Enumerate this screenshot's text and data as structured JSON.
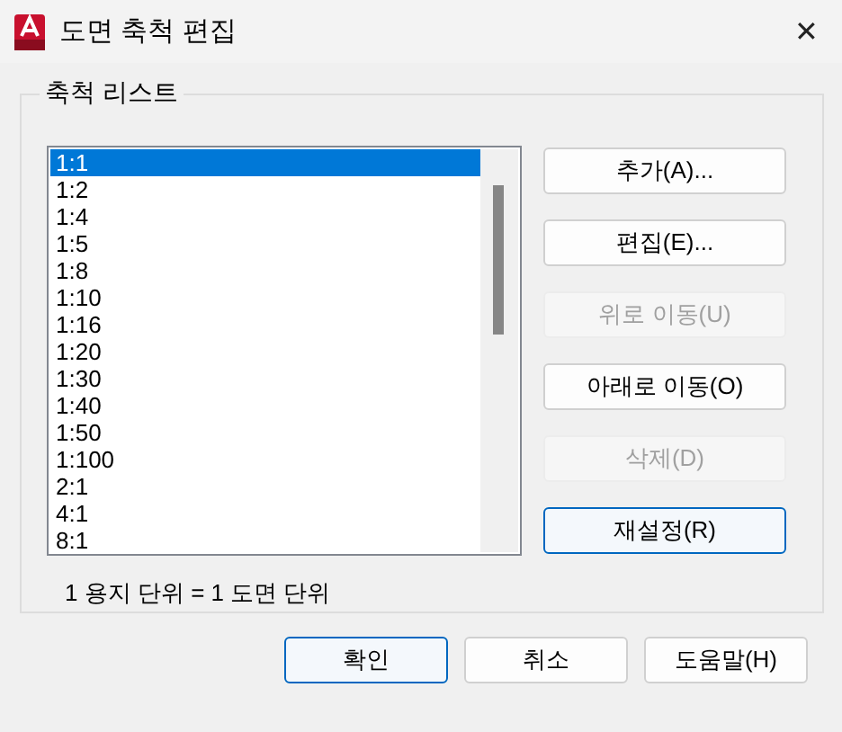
{
  "window": {
    "title": "도면 축척 편집",
    "close": "✕"
  },
  "group": {
    "title": "축척 리스트"
  },
  "scales": [
    {
      "label": "1:1",
      "selected": true
    },
    {
      "label": "1:2",
      "selected": false
    },
    {
      "label": "1:4",
      "selected": false
    },
    {
      "label": "1:5",
      "selected": false
    },
    {
      "label": "1:8",
      "selected": false
    },
    {
      "label": "1:10",
      "selected": false
    },
    {
      "label": "1:16",
      "selected": false
    },
    {
      "label": "1:20",
      "selected": false
    },
    {
      "label": "1:30",
      "selected": false
    },
    {
      "label": "1:40",
      "selected": false
    },
    {
      "label": "1:50",
      "selected": false
    },
    {
      "label": "1:100",
      "selected": false
    },
    {
      "label": "2:1",
      "selected": false
    },
    {
      "label": "4:1",
      "selected": false
    },
    {
      "label": "8:1",
      "selected": false
    }
  ],
  "side_buttons": [
    {
      "label": "추가(A)...",
      "disabled": false,
      "focused": false
    },
    {
      "label": "편집(E)...",
      "disabled": false,
      "focused": false
    },
    {
      "label": "위로 이동(U)",
      "disabled": true,
      "focused": false
    },
    {
      "label": "아래로 이동(O)",
      "disabled": false,
      "focused": false
    },
    {
      "label": "삭제(D)",
      "disabled": true,
      "focused": false
    },
    {
      "label": "재설정(R)",
      "disabled": false,
      "focused": true
    }
  ],
  "unit_note": "1 용지 단위 = 1 도면 단위",
  "footer_buttons": [
    {
      "label": "확인",
      "focused": true
    },
    {
      "label": "취소",
      "focused": false
    },
    {
      "label": "도움말(H)",
      "focused": false
    }
  ]
}
